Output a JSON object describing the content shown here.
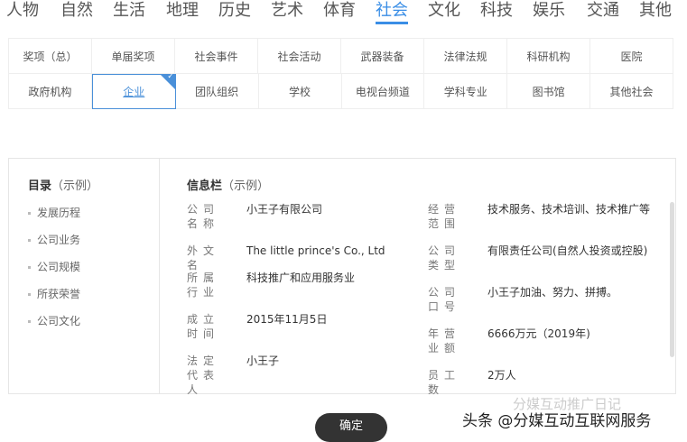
{
  "tabs": [
    "人物",
    "自然",
    "生活",
    "地理",
    "历史",
    "艺术",
    "体育",
    "社会",
    "文化",
    "科技",
    "娱乐",
    "交通",
    "其他"
  ],
  "active_tab": "社会",
  "subcategories": [
    [
      "奖项（总）",
      "单届奖项",
      "社会事件",
      "社会活动",
      "武器装备",
      "法律法规",
      "科研机构",
      "医院"
    ],
    [
      "政府机构",
      "企业",
      "团队组织",
      "学校",
      "电视台频道",
      "学科专业",
      "图书馆",
      "其他社会"
    ]
  ],
  "selected_subcategory": "企业",
  "catalog": {
    "title": "目录",
    "title_note": "（示例）",
    "items": [
      "发展历程",
      "公司业务",
      "公司规模",
      "所获荣誉",
      "公司文化"
    ]
  },
  "info": {
    "title": "信息栏",
    "title_note": "（示例）",
    "left": [
      {
        "label": "公司名称",
        "value": "小王子有限公司"
      },
      {
        "label": "外文名",
        "value": "The little prince's Co., Ltd"
      },
      {
        "label": "所属行业",
        "value": "科技推广和应用服务业"
      },
      {
        "label": "成立时间",
        "value": "2015年11月5日"
      },
      {
        "label": "法定代表人",
        "value": "小王子"
      }
    ],
    "right": [
      {
        "label": "经营范围",
        "value": "技术服务、技术培训、技术推广等"
      },
      {
        "label": "公司类型",
        "value": "有限责任公司(自然人投资或控股)"
      },
      {
        "label": "公司口号",
        "value": "小王子加油、努力、拼搏。"
      },
      {
        "label": "年营业额",
        "value": "6666万元（2019年)"
      },
      {
        "label": "员工数",
        "value": "2万人"
      }
    ]
  },
  "confirm_label": "确定",
  "watermark": "头条 @分媒互动互联网服务",
  "watermark2": "分媒互动推广日记",
  "accent": "#3a8ee6"
}
